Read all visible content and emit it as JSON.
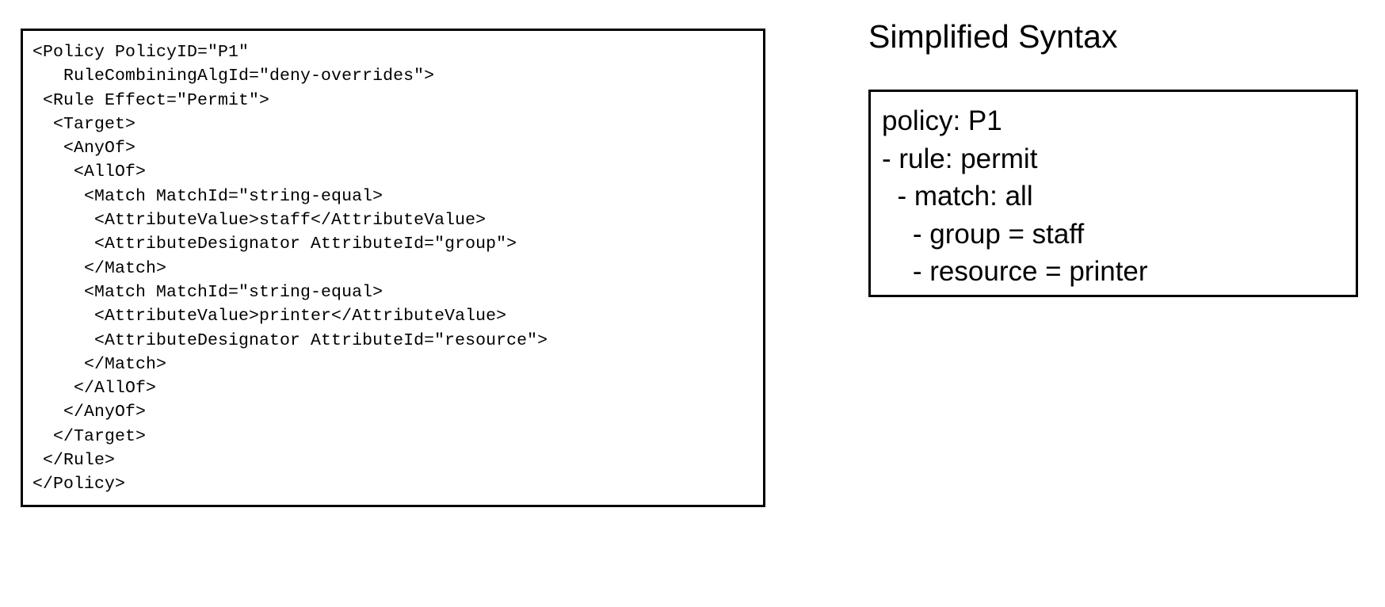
{
  "figure": {
    "xacml_panel": {
      "language": "XML",
      "lines": [
        "<Policy PolicyID=\"P1\"",
        "   RuleCombiningAlgId=\"deny-overrides\">",
        " <Rule Effect=\"Permit\">",
        "  <Target>",
        "   <AnyOf>",
        "    <AllOf>",
        "     <Match MatchId=\"string-equal>",
        "      <AttributeValue>staff</AttributeValue>",
        "      <AttributeDesignator AttributeId=\"group\">",
        "     </Match>",
        "     <Match MatchId=\"string-equal>",
        "      <AttributeValue>printer</AttributeValue>",
        "      <AttributeDesignator AttributeId=\"resource\">",
        "     </Match>",
        "    </AllOf>",
        "   </AnyOf>",
        "  </Target>",
        " </Rule>",
        "</Policy>"
      ],
      "text": "<Policy PolicyID=\"P1\"\n   RuleCombiningAlgId=\"deny-overrides\">\n <Rule Effect=\"Permit\">\n  <Target>\n   <AnyOf>\n    <AllOf>\n     <Match MatchId=\"string-equal>\n      <AttributeValue>staff</AttributeValue>\n      <AttributeDesignator AttributeId=\"group\">\n     </Match>\n     <Match MatchId=\"string-equal>\n      <AttributeValue>printer</AttributeValue>\n      <AttributeDesignator AttributeId=\"resource\">\n     </Match>\n    </AllOf>\n   </AnyOf>\n  </Target>\n </Rule>\n</Policy>"
    },
    "simplified_panel": {
      "title": "Simplified Syntax",
      "lines": [
        "policy: P1",
        "- rule: permit",
        "  - match: all",
        "    - group = staff",
        "    - resource = printer"
      ],
      "text": "policy: P1\n- rule: permit\n  - match: all\n    - group = staff\n    - resource = printer"
    },
    "colors": {
      "background": "#ffffff",
      "text": "#000000",
      "border": "#000000"
    }
  }
}
